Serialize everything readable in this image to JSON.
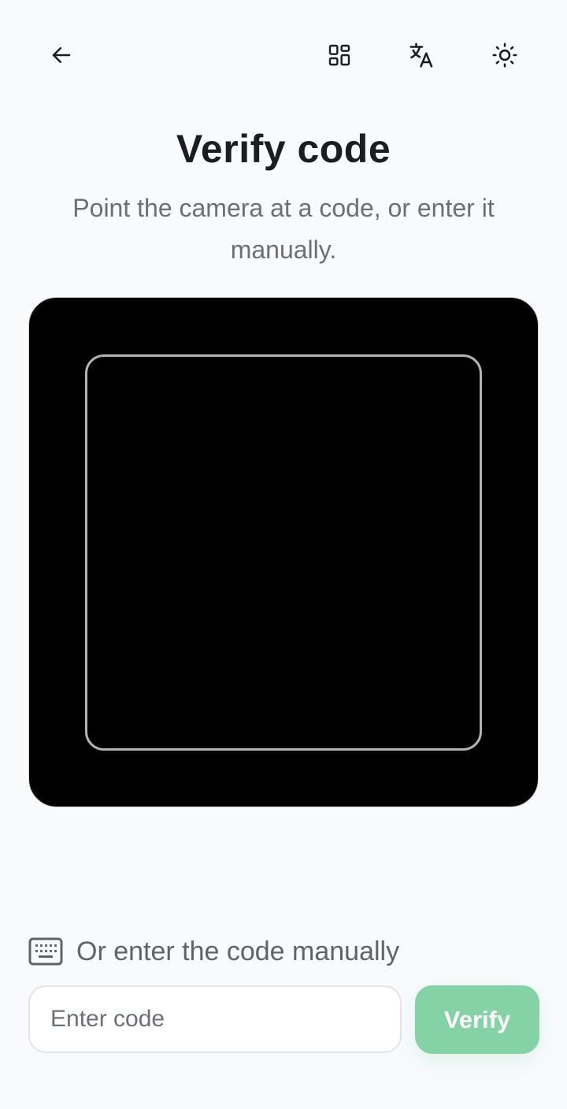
{
  "header": {
    "back_icon": "arrow-left-icon",
    "scan_icon": "grid-qr-icon",
    "translate_icon": "translate-icon",
    "theme_icon": "sun-icon"
  },
  "title": "Verify code",
  "subtitle": "Point the camera at a code, or enter it manually.",
  "manual": {
    "icon": "keyboard-icon",
    "label": "Or enter the code manually",
    "input_placeholder": "Enter code",
    "input_value": "",
    "verify_label": "Verify"
  },
  "colors": {
    "background": "#f8fafc",
    "camera": "#000000",
    "accent_disabled": "#86d2a7"
  }
}
